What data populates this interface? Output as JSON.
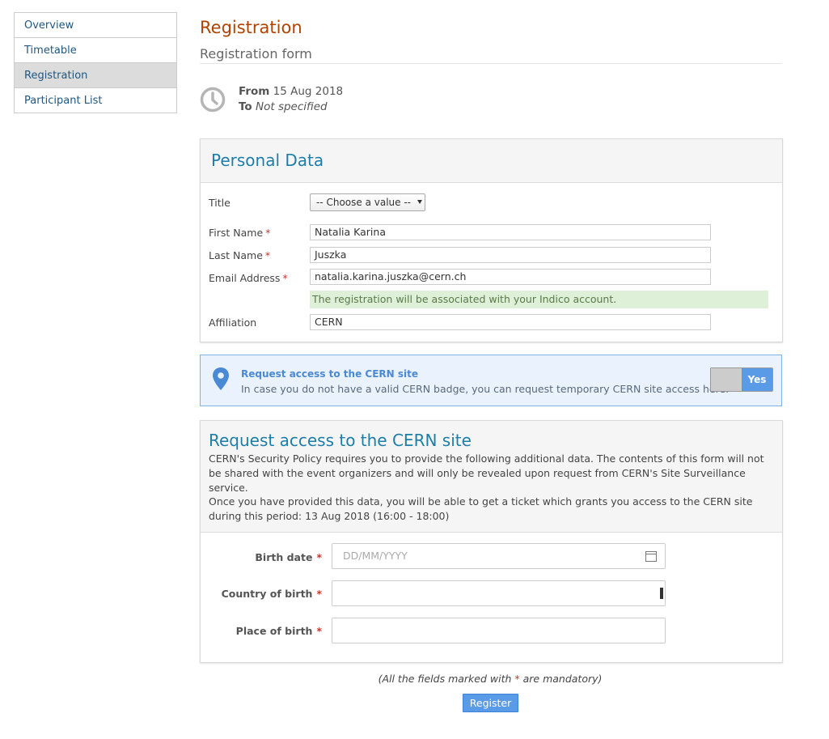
{
  "sidebar": {
    "items": [
      {
        "label": "Overview",
        "active": false
      },
      {
        "label": "Timetable",
        "active": false
      },
      {
        "label": "Registration",
        "active": true
      },
      {
        "label": "Participant List",
        "active": false
      }
    ]
  },
  "header": {
    "title": "Registration",
    "subtitle": "Registration form"
  },
  "dates": {
    "from_label": "From",
    "from_value": "15 Aug 2018",
    "to_label": "To",
    "to_value": "Not specified"
  },
  "personal_data": {
    "title": "Personal Data",
    "title_label": "Title",
    "title_value": "-- Choose a value --",
    "first_name_label": "First Name",
    "first_name_value": "Natalia Karina",
    "last_name_label": "Last Name",
    "last_name_value": "Juszka",
    "email_label": "Email Address",
    "email_value": "natalia.karina.juszka@cern.ch",
    "email_info": "The registration will be associated with your Indico account.",
    "affiliation_label": "Affiliation",
    "affiliation_value": "CERN",
    "required_mark": "*"
  },
  "access_banner": {
    "title": "Request access to the CERN site",
    "description": "In case you do not have a valid CERN badge, you can request temporary CERN site access here.",
    "toggle_label": "Yes",
    "toggle_on": true
  },
  "cern_form": {
    "title": "Request access to the CERN site",
    "paragraph1": "CERN's Security Policy requires you to provide the following additional data. The contents of this form will not be shared with the event organizers and will only be revealed upon request from CERN's Site Surveillance service.",
    "paragraph2": "Once you have provided this data, you will be able to get a ticket which grants you access to the CERN site during this period: 13 Aug 2018 (16:00 - 18:00)",
    "birth_date_label": "Birth date",
    "birth_date_placeholder": "DD/MM/YYYY",
    "country_label": "Country of birth",
    "place_label": "Place of birth"
  },
  "footer": {
    "mandatory_prefix": "(All the fields marked with ",
    "mandatory_star": "*",
    "mandatory_suffix": " are mandatory)",
    "register_label": "Register"
  },
  "colors": {
    "title": "#b14300",
    "panel_title": "#1d7ea8",
    "link": "#1f5780",
    "primary_button": "#5a9be8",
    "banner_bg": "#eaf2fd",
    "success_bg": "#dff0d8",
    "required": "#c0392b"
  }
}
